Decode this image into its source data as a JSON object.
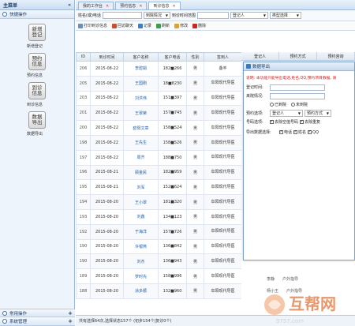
{
  "sidebar": {
    "title": "主菜单",
    "collapse_glyph": "«",
    "quick_group": "快捷操作",
    "quick_items": [
      {
        "icon_text": "新增\n登记",
        "label": "新增登记"
      },
      {
        "icon_text": "预约\n信息",
        "label": "预约信息"
      },
      {
        "icon_text": "到诊\n信息",
        "label": "到诊信息"
      },
      {
        "icon_text": "数据\n导出",
        "label": "数据导出"
      }
    ],
    "bottom_groups": [
      "常用操作",
      "系统管理"
    ]
  },
  "tabs": [
    {
      "label": "我的工作台",
      "active": false
    },
    {
      "label": "预约信息",
      "active": false
    },
    {
      "label": "到诊信息",
      "active": true
    }
  ],
  "search": {
    "name_label": "姓名(或)电话",
    "status_value": "到院情况",
    "time_label": "到诊时间范围",
    "reg_value": "登记人",
    "type_value": "类型选择"
  },
  "toolbar": {
    "print": "打印到诊信息",
    "revisit": "回访聊天",
    "record": "记录",
    "refresh": "刷新",
    "edit": "修改",
    "delete": "删除"
  },
  "table": {
    "columns": [
      "ID",
      "到诊时间",
      "客户名称",
      "客户电话",
      "性别",
      "签到人"
    ],
    "rows": [
      [
        "206",
        "2015-08-22",
        "李碧娟",
        "182■266",
        "男",
        "桑丰"
      ],
      [
        "205",
        "2015-08-22",
        "王国刚",
        "18■8230",
        "男",
        "阜阳现代导医"
      ],
      [
        "203",
        "2015-08-22",
        "刘洪伟",
        "151■397",
        "男",
        "阜阳现代导医"
      ],
      [
        "201",
        "2015-08-22",
        "王翠荣",
        "157■745",
        "男",
        "阜阳现代导医"
      ],
      [
        "200",
        "2015-08-22",
        "欧阳文章",
        "158■524",
        "男",
        "阜阳现代导医"
      ],
      [
        "198",
        "2015-08-22",
        "王先生",
        "158■526",
        "男",
        "阜阳现代导医"
      ],
      [
        "197",
        "2015-08-22",
        "周齐",
        "188■750",
        "男",
        "阜阳现代导医"
      ],
      [
        "196",
        "2015-08-21",
        "顾金民",
        "182■959",
        "男",
        "阜阳现代导医"
      ],
      [
        "195",
        "2015-08-21",
        "刘军",
        "152■624",
        "男",
        "阜阳现代导医"
      ],
      [
        "194",
        "2015-08-20",
        "王小翠",
        "181■320",
        "男",
        "阜阳现代导医"
      ],
      [
        "193",
        "2015-08-20",
        "刘鑫",
        "134■123",
        "男",
        "阜阳现代导医"
      ],
      [
        "192",
        "2015-08-20",
        "于海洋",
        "157■726",
        "男",
        "阜阳现代导医"
      ],
      [
        "190",
        "2015-08-20",
        "许银燕",
        "136■842",
        "男",
        "阜阳现代导医"
      ],
      [
        "190",
        "2015-08-20",
        "刘杰",
        "136■943",
        "男",
        "阜阳现代导医"
      ],
      [
        "189",
        "2015-08-20",
        "罗时先",
        "158■996",
        "男",
        "阜阳现代导医"
      ],
      [
        "188",
        "2015-08-20",
        "涂多顺",
        "132■960",
        "男",
        "阜阳现代导医"
      ]
    ]
  },
  "right_columns": [
    "登记人",
    "预约方式",
    "预约咨询"
  ],
  "status": "共有选择64次,选择状态157个 (初步154个|复诊0个)",
  "dialog": {
    "title": "数据导出",
    "note": "说明: 本功能只能导出电话,姓名,QQ,预约项目数据, 请",
    "fields": [
      {
        "label": "登记时间:"
      },
      {
        "label": "来院情况:"
      },
      {
        "label": "预约选项:"
      },
      {
        "label": "号码选项:"
      }
    ],
    "visit_options": [
      "已到院",
      "未到院"
    ],
    "reg_select": "登记人",
    "reg_select2": "预约方式",
    "num_options": [
      "去除空值号码",
      "去除重复"
    ],
    "export_label": "导出数据选择:",
    "export_options": [
      "电话",
      "姓名",
      "QQ"
    ]
  },
  "extra_rows": [
    {
      "a": "李静",
      "b": "户外指导"
    },
    {
      "a": "杨小王",
      "b": "户外指导"
    }
  ],
  "watermark": {
    "big": "互帮网",
    "small": "9757.com"
  }
}
